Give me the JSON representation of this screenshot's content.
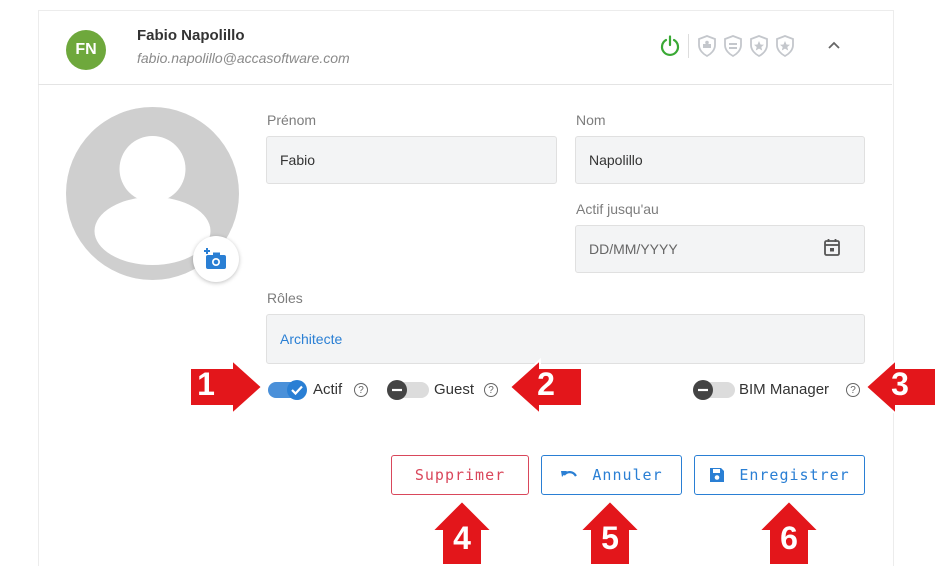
{
  "header": {
    "initials": "FN",
    "name": "Fabio Napolillo",
    "email": "fabio.napolillo@accasoftware.com",
    "icons": [
      "power-icon",
      "shield-icon",
      "shield-icon",
      "shield-star-icon",
      "shield-star-icon",
      "chevron-up-icon"
    ]
  },
  "form": {
    "prenom_label": "Prénom",
    "prenom_value": "Fabio",
    "nom_label": "Nom",
    "nom_value": "Napolillo",
    "actif_label": "Actif jusqu'au",
    "actif_placeholder": "DD/MM/YYYY",
    "roles_label": "Rôles",
    "roles_value": "Architecte"
  },
  "toggles": {
    "actif_label": "Actif",
    "actif_on": true,
    "guest_label": "Guest",
    "guest_on": false,
    "bim_label": "BIM Manager",
    "bim_on": false
  },
  "buttons": {
    "delete_label": "Supprimer",
    "cancel_label": "Annuler",
    "save_label": "Enregistrer"
  },
  "annotations": [
    "1",
    "2",
    "3",
    "4",
    "5",
    "6"
  ],
  "colors": {
    "accent": "#2a7fd4",
    "danger": "#d9475b",
    "avatar": "#6ea83c",
    "power": "#3aa935",
    "arrow": "#e3161b"
  }
}
